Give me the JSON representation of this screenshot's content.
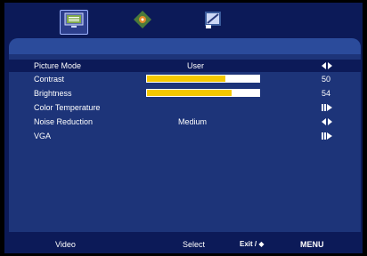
{
  "tabs": [
    {
      "icon": "picture-icon",
      "active": true
    },
    {
      "icon": "sound-icon",
      "active": false
    },
    {
      "icon": "setup-icon",
      "active": false
    }
  ],
  "menu": [
    {
      "label": "Picture Mode",
      "value": "User",
      "control": "left-right-arrows-icon"
    },
    {
      "label": "Contrast",
      "level": 50,
      "number": "50"
    },
    {
      "label": "Brightness",
      "level": 54,
      "number": "54"
    },
    {
      "label": "Color Temperature",
      "control": "enter-arrow-icon"
    },
    {
      "label": "Noise Reduction",
      "value": "Medium",
      "control": "left-right-arrows-icon"
    },
    {
      "label": "VGA",
      "control": "enter-arrow-icon"
    }
  ],
  "footer": {
    "source": "Video",
    "select_label": "Select",
    "nav_label": "Exit / ◆",
    "menu_label": "MENU"
  },
  "colors": {
    "background": "#0c1a58",
    "panel": "#1d3479",
    "bar_fill": "#f4c800"
  }
}
